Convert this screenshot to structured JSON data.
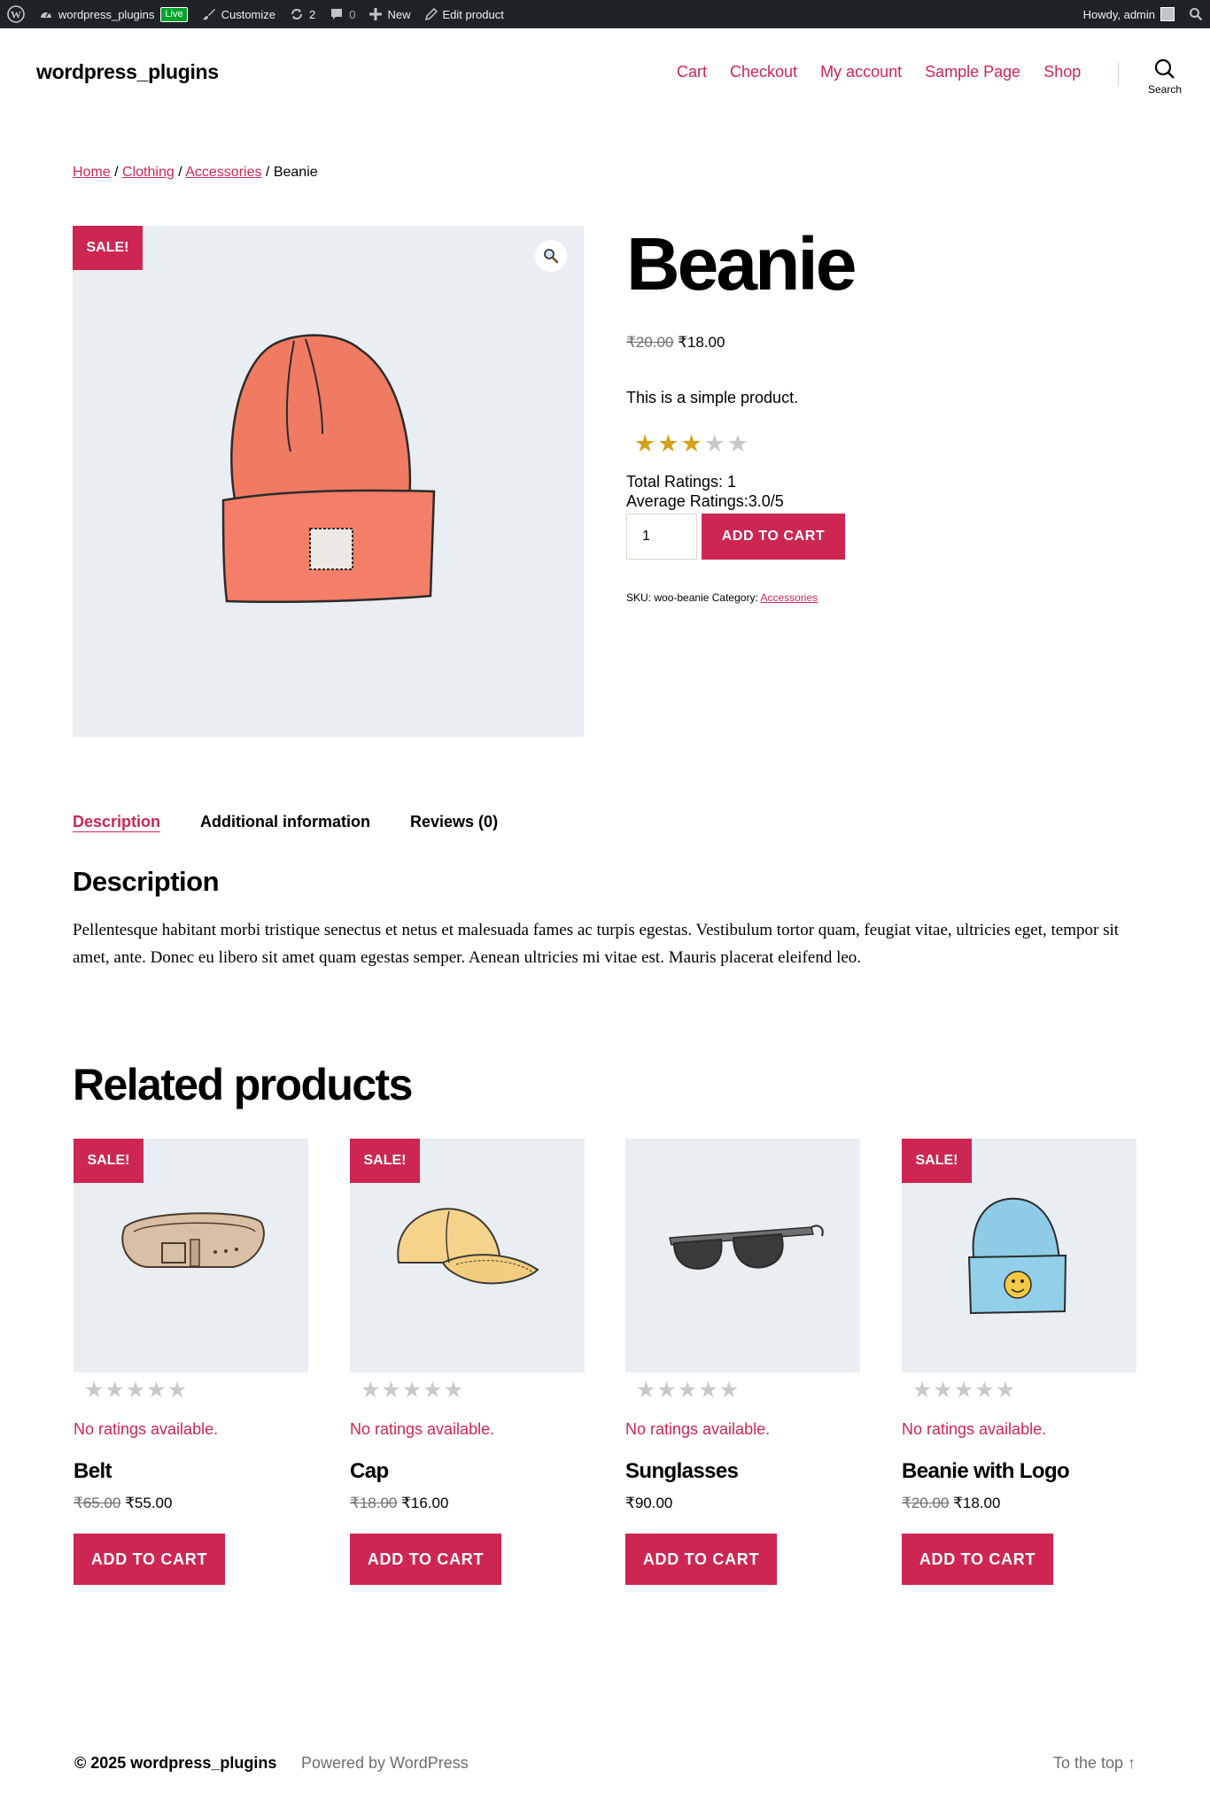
{
  "admin_bar": {
    "site_name": "wordpress_plugins",
    "live_badge": "Live",
    "customize": "Customize",
    "updates_count": "2",
    "comments_count": "0",
    "new": "New",
    "edit_product": "Edit product",
    "howdy": "Howdy, admin"
  },
  "header": {
    "site_title": "wordpress_plugins",
    "nav": [
      "Cart",
      "Checkout",
      "My account",
      "Sample Page",
      "Shop"
    ],
    "search_label": "Search"
  },
  "breadcrumb": {
    "home": "Home",
    "clothing": "Clothing",
    "accessories": "Accessories",
    "current": "Beanie",
    "separator": "/"
  },
  "product": {
    "sale_badge": "Sale!",
    "title": "Beanie",
    "regular_price": "₹20.00",
    "sale_price": "₹18.00",
    "short_description": "This is a simple product.",
    "rating": 3,
    "rating_max": 5,
    "total_ratings": "Total Ratings: 1",
    "average_ratings": "Average Ratings:3.0/5",
    "quantity": "1",
    "add_to_cart": "Add to cart",
    "sku_label": "SKU:",
    "sku": "woo-beanie",
    "category_label": "Category:",
    "category": "Accessories"
  },
  "tabs": {
    "items": [
      "Description",
      "Additional information",
      "Reviews (0)"
    ],
    "active": "Description"
  },
  "description": {
    "heading": "Description",
    "body": "Pellentesque habitant morbi tristique senectus et netus et malesuada fames ac turpis egestas. Vestibulum tortor quam, feugiat vitae, ultricies eget, tempor sit amet, ante. Donec eu libero sit amet quam egestas semper. Aenean ultricies mi vitae est. Mauris placerat eleifend leo."
  },
  "related": {
    "heading": "Related products",
    "no_ratings": "No ratings available.",
    "add_to_cart": "Add to cart",
    "sale_badge": "Sale!",
    "products": [
      {
        "name": "Belt",
        "regular_price": "₹65.00",
        "sale_price": "₹55.00",
        "on_sale": true,
        "icon": "belt-icon"
      },
      {
        "name": "Cap",
        "regular_price": "₹18.00",
        "sale_price": "₹16.00",
        "on_sale": true,
        "icon": "cap-icon"
      },
      {
        "name": "Sunglasses",
        "regular_price": "",
        "sale_price": "₹90.00",
        "on_sale": false,
        "icon": "sunglasses-icon"
      },
      {
        "name": "Beanie with Logo",
        "regular_price": "₹20.00",
        "sale_price": "₹18.00",
        "on_sale": true,
        "icon": "beanie-logo-icon"
      }
    ]
  },
  "footer": {
    "copyright": "© 2025 wordpress_plugins",
    "powered_by": "Powered by WordPress",
    "to_top": "To the top ↑"
  },
  "colors": {
    "accent": "#cd2653",
    "admin_bar": "#1d2327",
    "image_bg": "#e9eef2",
    "star_on": "#d4a11b",
    "star_off": "#c9c9c9"
  }
}
